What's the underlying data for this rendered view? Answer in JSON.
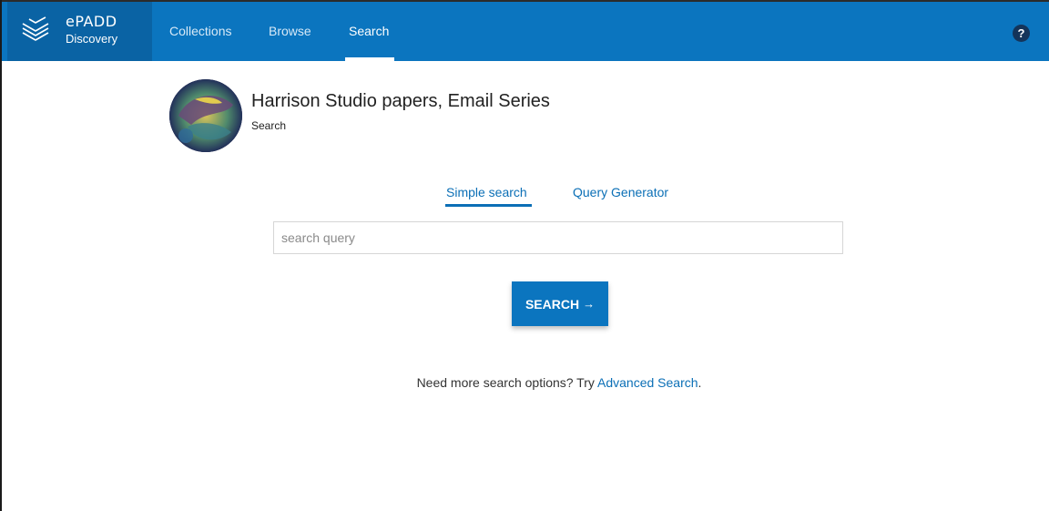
{
  "brand": {
    "line1": "ePADD",
    "line2": "Discovery",
    "logo_icon": "stacked-layers-icon"
  },
  "nav": {
    "items": [
      {
        "label": "Collections",
        "active": false
      },
      {
        "label": "Browse",
        "active": false
      },
      {
        "label": "Search",
        "active": true
      }
    ],
    "help_icon": "question-circle-icon",
    "help_glyph": "?"
  },
  "collection": {
    "title": "Harrison Studio papers, Email Series",
    "subtitle": "Search"
  },
  "tabs": [
    {
      "label": "Simple search",
      "active": true
    },
    {
      "label": "Query Generator",
      "active": false
    }
  ],
  "search": {
    "placeholder": "search query",
    "value": "",
    "button_label": "SEARCH",
    "button_icon": "arrow-right-icon",
    "button_arrow": "→"
  },
  "more_options": {
    "prefix": "Need more search options? Try",
    "link": "Advanced Search",
    "suffix": "."
  },
  "colors": {
    "nav_bg": "#0b75bf",
    "brand_bg": "#0a63a4",
    "link": "#0b6fb6",
    "button": "#0b75bf"
  }
}
